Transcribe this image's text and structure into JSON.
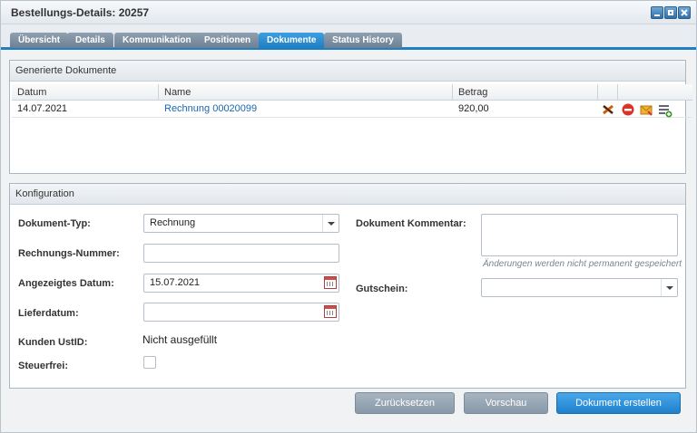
{
  "window": {
    "title": "Bestellungs-Details: 20257"
  },
  "window_buttons": {
    "minimize": "minimize-icon",
    "maximize": "maximize-icon",
    "close": "close-icon"
  },
  "tabs": [
    {
      "label": "Übersicht"
    },
    {
      "label": "Details"
    },
    {
      "label": "Kommunikation"
    },
    {
      "label": "Positionen"
    },
    {
      "label": "Dokumente",
      "active": true
    },
    {
      "label": "Status History"
    }
  ],
  "documents_panel": {
    "title": "Generierte Dokumente",
    "columns": [
      "Datum",
      "Name",
      "Betrag"
    ],
    "rows": [
      {
        "datum": "14.07.2021",
        "name": "Rechnung 00020099",
        "betrag": "920,00",
        "actions": [
          "delete-x-icon",
          "cancel-icon",
          "send-mail-icon",
          "add-list-icon"
        ]
      }
    ]
  },
  "config_panel": {
    "title": "Konfiguration",
    "dokument_typ": {
      "label": "Dokument-Typ:",
      "value": "Rechnung"
    },
    "rechnungs_nummer": {
      "label": "Rechnungs-Nummer:",
      "value": ""
    },
    "angezeigtes_datum": {
      "label": "Angezeigtes Datum:",
      "value": "15.07.2021"
    },
    "lieferdatum": {
      "label": "Lieferdatum:",
      "value": ""
    },
    "kunden_ustid": {
      "label": "Kunden UstID:",
      "value": "Nicht ausgefüllt"
    },
    "steuerfrei": {
      "label": "Steuerfrei:",
      "checked": false
    },
    "kommentar": {
      "label": "Dokument Kommentar:",
      "value": "",
      "hint": "Änderungen werden nicht permanent gespeichert"
    },
    "gutschein": {
      "label": "Gutschein:",
      "value": ""
    }
  },
  "buttons": {
    "reset": "Zurücksetzen",
    "preview": "Vorschau",
    "create": "Dokument erstellen"
  },
  "colors": {
    "accent": "#1e7fc2",
    "link": "#1a66b3"
  }
}
